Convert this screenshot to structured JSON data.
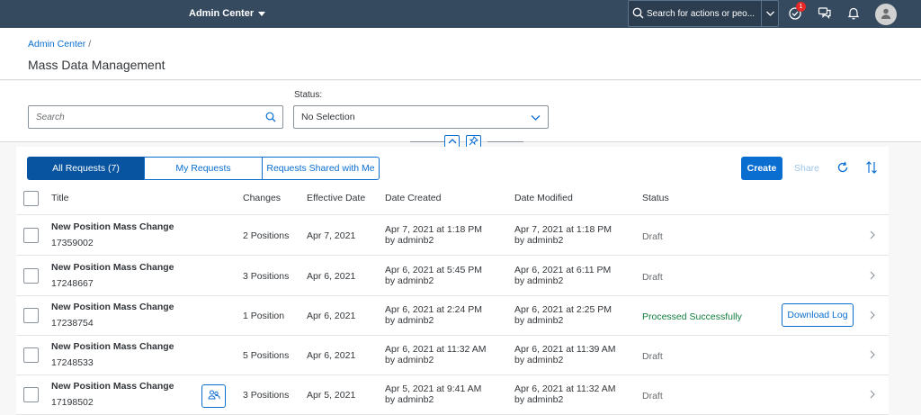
{
  "shell": {
    "title": "Admin Center",
    "search_placeholder": "Search for actions or peo...",
    "notification_count": "1"
  },
  "header": {
    "breadcrumb": "Admin Center",
    "breadcrumb_sep": "/",
    "title": "Mass Data Management"
  },
  "filters": {
    "search_placeholder": "Search",
    "status_label": "Status:",
    "status_value": "No Selection"
  },
  "tabs": [
    {
      "label": "All Requests (7)",
      "active": true
    },
    {
      "label": "My Requests",
      "active": false
    },
    {
      "label": "Requests Shared with Me",
      "active": false
    }
  ],
  "toolbar": {
    "create_label": "Create",
    "share_label": "Share"
  },
  "table": {
    "columns": [
      "Title",
      "Changes",
      "Effective Date",
      "Date Created",
      "Date Modified",
      "Status"
    ],
    "rows": [
      {
        "title": "New Position Mass Change",
        "id": "17359002",
        "changes": "2 Positions",
        "effective": "Apr 7, 2021",
        "created": "Apr 7, 2021 at 1:18 PM",
        "created_by": "by adminb2",
        "modified": "Apr 7, 2021 at 1:18 PM",
        "modified_by": "by adminb2",
        "status": "Draft"
      },
      {
        "title": "New Position Mass Change",
        "id": "17248667",
        "changes": "3 Positions",
        "effective": "Apr 6, 2021",
        "created": "Apr 6, 2021 at 5:45 PM",
        "created_by": "by adminb2",
        "modified": "Apr 6, 2021 at 6:11 PM",
        "modified_by": "by adminb2",
        "status": "Draft"
      },
      {
        "title": "New Position Mass Change",
        "id": "17238754",
        "changes": "1 Position",
        "effective": "Apr 6, 2021",
        "created": "Apr 6, 2021 at 2:24 PM",
        "created_by": "by adminb2",
        "modified": "Apr 6, 2021 at 2:25 PM",
        "modified_by": "by adminb2",
        "status": "Processed Successfully",
        "action": "Download Log"
      },
      {
        "title": "New Position Mass Change",
        "id": "17248533",
        "changes": "5 Positions",
        "effective": "Apr 6, 2021",
        "created": "Apr 6, 2021 at 11:32 AM",
        "created_by": "by adminb2",
        "modified": "Apr 6, 2021 at 11:39 AM",
        "modified_by": "by adminb2",
        "status": "Draft"
      },
      {
        "title": "New Position Mass Change",
        "id": "17198502",
        "changes": "3 Positions",
        "effective": "Apr 5, 2021",
        "created": "Apr 5, 2021 at 9:41 AM",
        "created_by": "by adminb2",
        "modified": "Apr 6, 2021 at 11:32 AM",
        "modified_by": "by adminb2",
        "status": "Draft"
      }
    ]
  },
  "colors": {
    "shell": "#354a5f",
    "accent": "#0a6ed1",
    "success": "#107e3e"
  }
}
